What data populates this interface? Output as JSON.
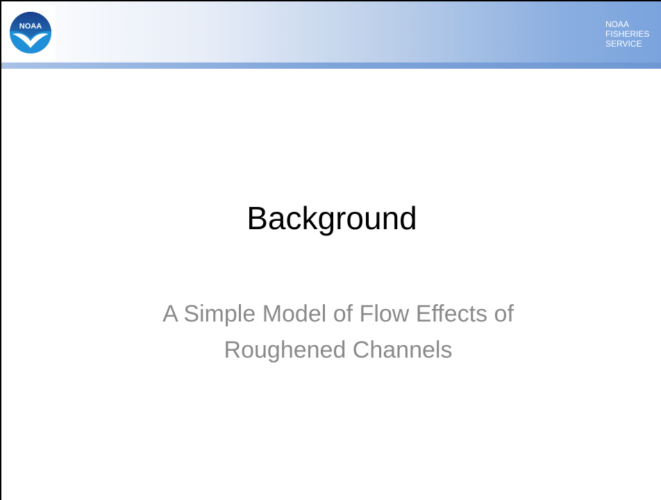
{
  "header": {
    "logo_text": "NOAA",
    "agency_lines": [
      "NOAA",
      "FISHERIES",
      "SERVICE"
    ]
  },
  "slide": {
    "title": "Background",
    "subtitle_lines": [
      "A Simple Model of Flow Effects of",
      "Roughened Channels"
    ]
  },
  "colors": {
    "header_gradient_end": "#7aa3dd",
    "noaa_blue": "#1f6fb5",
    "subtitle_gray": "#8a8a8a"
  }
}
